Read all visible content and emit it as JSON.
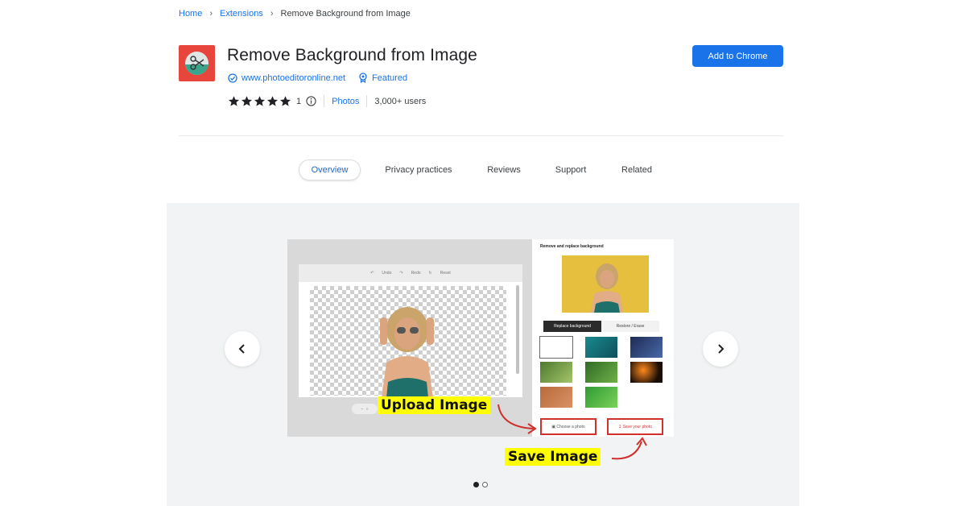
{
  "breadcrumb": {
    "home": "Home",
    "extensions": "Extensions",
    "current": "Remove Background from Image"
  },
  "extension": {
    "title": "Remove Background from Image",
    "website": "www.photoeditoronline.net",
    "featured": "Featured",
    "rating_value": 5,
    "rating_count": "1",
    "category": "Photos",
    "users": "3,000+ users",
    "add_button": "Add to Chrome"
  },
  "tabs": [
    {
      "label": "Overview",
      "active": true
    },
    {
      "label": "Privacy practices"
    },
    {
      "label": "Reviews"
    },
    {
      "label": "Support"
    },
    {
      "label": "Related"
    }
  ],
  "screenshot": {
    "toolbar": {
      "undo": "Undo",
      "redo": "Redo",
      "reset": "Reset"
    },
    "panel_title": "Remove and replace background",
    "panel_tab_replace": "Replace background",
    "panel_tab_restore": "Restore / Erase",
    "choose_button": "Choose a photo",
    "save_button": "Save your photo",
    "upload_callout": "Upload Image",
    "save_callout": "Save Image"
  },
  "carousel": {
    "slide_count": 2,
    "active_slide": 1
  },
  "colors": {
    "accent": "#1a73e8",
    "callout": "#ffff00",
    "highlight_border": "#d0312d",
    "icon_bg": "#e8453c"
  }
}
